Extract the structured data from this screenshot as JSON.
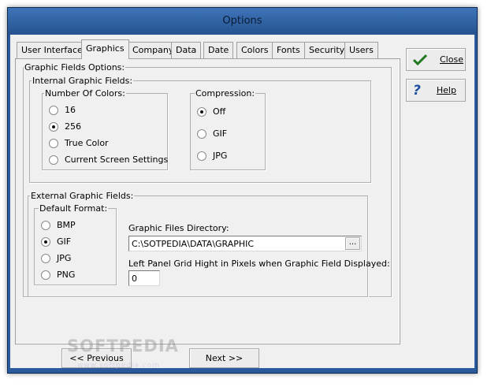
{
  "window": {
    "title": "Options"
  },
  "tabs": [
    {
      "label": "User Interface"
    },
    {
      "label": "Graphics"
    },
    {
      "label": "Company"
    },
    {
      "label": "Data"
    },
    {
      "label": "Date"
    },
    {
      "label": "Colors"
    },
    {
      "label": "Fonts"
    },
    {
      "label": "Security"
    },
    {
      "label": "Users"
    }
  ],
  "active_tab": "Graphics",
  "graphic_fields": {
    "legend": "Graphic Fields Options:",
    "internal": {
      "legend": "Internal Graphic Fields:",
      "colors": {
        "legend": "Number Of Colors:",
        "options": [
          "16",
          "256",
          "True Color",
          "Current Screen Settings"
        ],
        "selected": "256"
      },
      "compression": {
        "legend": "Compression:",
        "options": [
          "Off",
          "GIF",
          "JPG"
        ],
        "selected": "Off"
      }
    },
    "external": {
      "legend": "External Graphic Fields:",
      "format": {
        "legend": "Default Format:",
        "options": [
          "BMP",
          "GIF",
          "JPG",
          "PNG"
        ],
        "selected": "GIF"
      },
      "directory_label": "Graphic Files Directory:",
      "directory_value": "C:\\SOTPEDIA\\DATA\\GRAPHIC",
      "browse_label": "...",
      "grid_height_label": "Left Panel Grid Hight in Pixels when Graphic Field Displayed:",
      "grid_height_value": "0"
    }
  },
  "buttons": {
    "close": "Close",
    "help": "Help",
    "previous": "<< Previous",
    "next": "Next >>"
  },
  "watermark": {
    "text": "SOFTPEDIA",
    "url": "www.softpedia.com"
  },
  "icons": {
    "close": "check-icon",
    "help": "question-icon"
  },
  "colors": {
    "title_bar": "#2a5a9c",
    "check": "#1f7a1f",
    "help": "#1f4fa0"
  }
}
